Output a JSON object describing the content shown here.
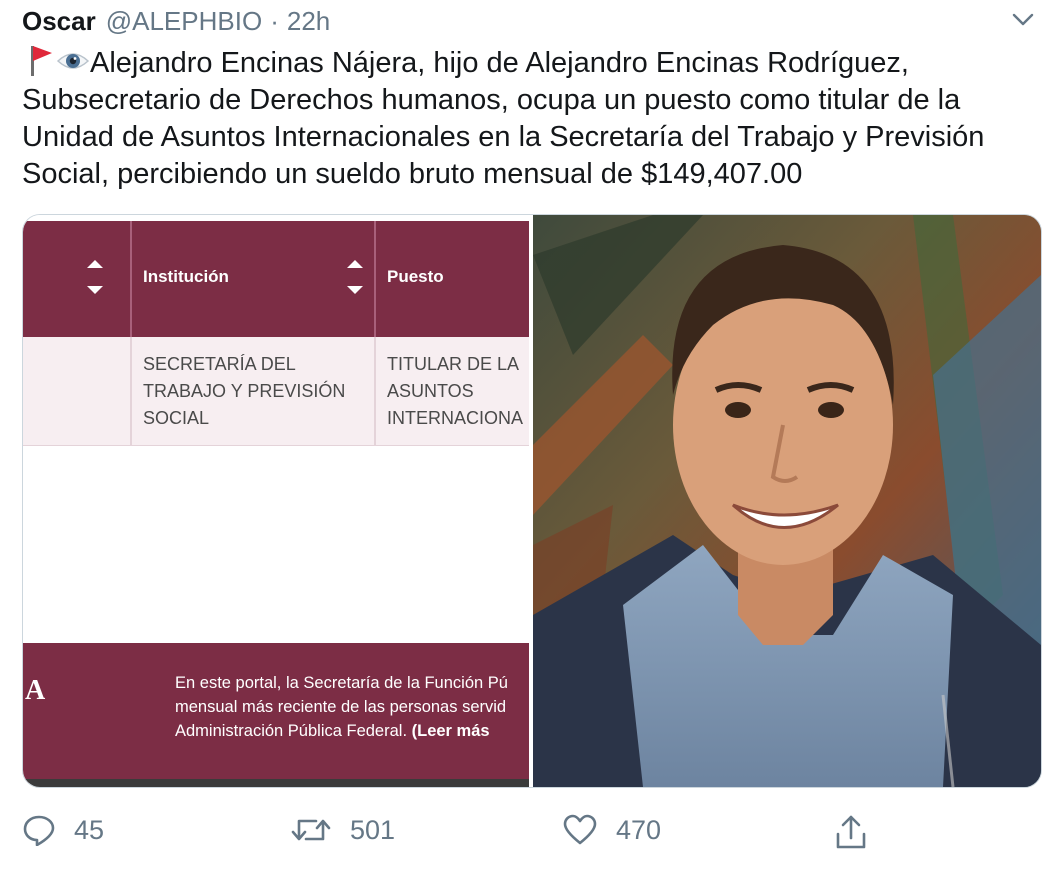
{
  "tweet": {
    "display_name": "Oscar",
    "handle": "@ALEPHBIO",
    "separator": "·",
    "time": "22h",
    "text": "Alejandro Encinas Nájera, hijo de Alejandro Encinas Rodríguez, Subsecretario de Derechos humanos, ocupa un puesto como titular de la Unidad de Asuntos Internacionales en la Secretaría del Trabajo y Previsión Social, percibiendo un sueldo bruto mensual de $149,407.00",
    "emojis": [
      "red-flag-icon",
      "eye-icon"
    ]
  },
  "screenshot": {
    "columns": [
      "Institución",
      "Puesto"
    ],
    "row": {
      "institucion": "SECRETARÍA DEL\nTRABAJO Y PREVISIÓN\nSOCIAL",
      "puesto": "TITULAR DE LA\nASUNTOS\nINTERNACIONA"
    },
    "footer_letter": "A",
    "footer_lines": [
      "En este portal, la Secretaría de la Función Pú",
      "mensual más reciente de las personas servid",
      "Administración Pública Federal."
    ],
    "footer_link": "(Leer más"
  },
  "actions": {
    "replies": "45",
    "retweets": "501",
    "likes": "470"
  },
  "colors": {
    "accent_maroon": "#7c2d45",
    "secondary_text": "#657786"
  }
}
